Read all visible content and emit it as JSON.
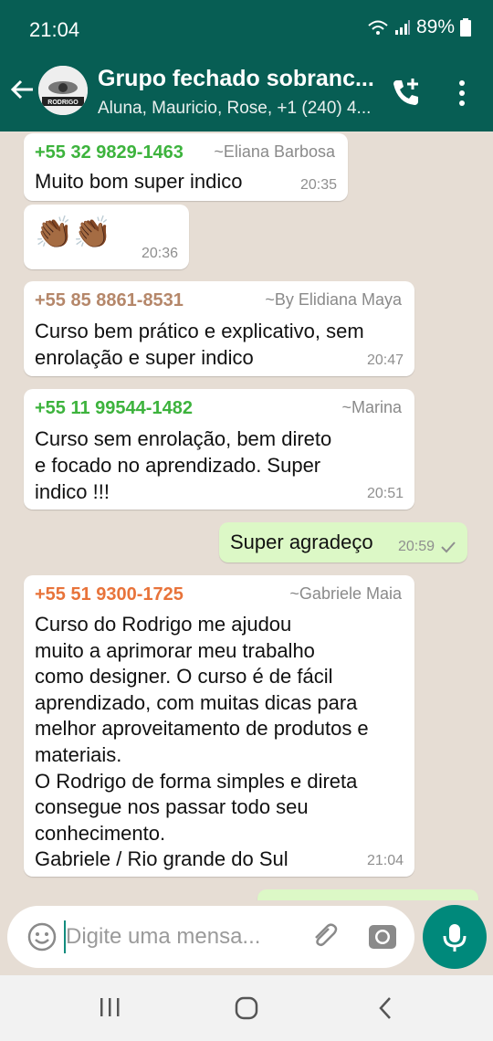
{
  "status_bar": {
    "time": "21:04",
    "battery": "89%"
  },
  "header": {
    "title": "Grupo fechado sobranc...",
    "subtitle": "Aluna, Mauricio, Rose, +1 (240) 4...",
    "avatar_text": "RODRIGO"
  },
  "colors": {
    "header": "#075e54",
    "outgoing_bubble": "#dcf8c6",
    "sender_green": "#3db33d",
    "sender_brown": "#b5876a",
    "sender_orange": "#e8733a"
  },
  "messages": [
    {
      "sender": "+55 32 9829-1463",
      "alias": "~Eliana Barbosa",
      "text": "Muito bom super indico",
      "time": "20:35"
    },
    {
      "text": "👏🏾👏🏾",
      "time": "20:36"
    },
    {
      "sender": "+55 85 8861-8531",
      "alias": "~By Elidiana Maya",
      "text": "Curso bem prático e explicativo, sem\nenrolação e super indico",
      "time": "20:47"
    },
    {
      "sender": "+55 11 99544-1482",
      "alias": "~Marina",
      "text": "Curso sem enrolação, bem direto\ne focado no aprendizado. Super\nindico !!!",
      "time": "20:51"
    },
    {
      "text": "Super agradeço",
      "time": "20:59",
      "outgoing": true
    },
    {
      "sender": "+55 51 9300-1725",
      "alias": "~Gabriele Maia",
      "text": "Curso do Rodrigo me ajudou\nmuito a aprimorar meu trabalho\ncomo designer. O curso é de fácil\naprendizado, com muitas dicas para\nmelhor aproveitamento de produtos e\nmateriais.\nO Rodrigo de forma simples e direta\nconsegue nos passar todo seu\nconhecimento.\nGabriele / Rio grande do Sul",
      "time": "21:04"
    }
  ],
  "input": {
    "placeholder": "Digite uma mensa..."
  },
  "icons": [
    "back-arrow-icon",
    "add-call-icon",
    "more-vert-icon",
    "emoji-icon",
    "attach-icon",
    "camera-icon",
    "mic-icon",
    "check-icon"
  ]
}
